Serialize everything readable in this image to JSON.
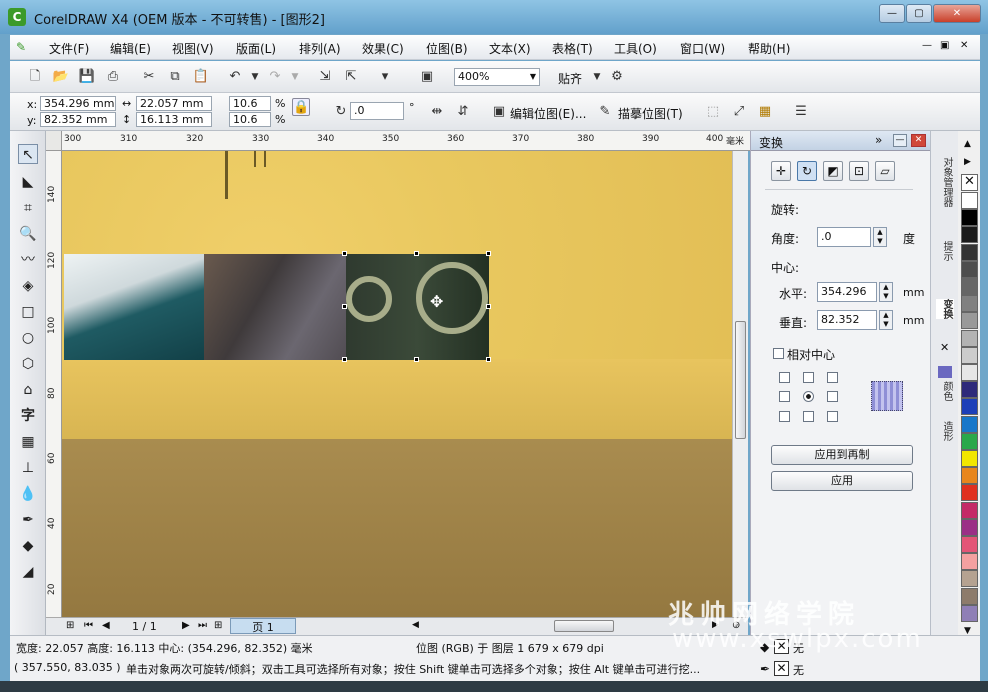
{
  "window": {
    "title": "CorelDRAW X4 (OEM 版本 - 不可转售) - [图形2]",
    "icon": "coreldraw-icon"
  },
  "menu": [
    "文件(F)",
    "编辑(E)",
    "视图(V)",
    "版面(L)",
    "排列(A)",
    "效果(C)",
    "位图(B)",
    "文本(X)",
    "表格(T)",
    "工具(O)",
    "窗口(W)",
    "帮助(H)"
  ],
  "toolbar": {
    "zoom": "400%",
    "snap_label": "贴齐"
  },
  "propbar": {
    "x_label": "x:",
    "x": "354.296 mm",
    "y_label": "y:",
    "y": "82.352 mm",
    "w": "22.057 mm",
    "h": "16.113 mm",
    "sx": "10.6",
    "sy": "10.6",
    "pct": "%",
    "rotation": ".0",
    "deg": "°",
    "edit_bitmap": "编辑位图(E)...",
    "trace_bitmap": "描摹位图(T)"
  },
  "ruler": {
    "top": [
      "300",
      "310",
      "320",
      "330",
      "340",
      "350",
      "360",
      "370",
      "380",
      "390",
      "400"
    ],
    "unit": "毫米",
    "left": [
      "140",
      "120",
      "100",
      "80",
      "60",
      "40",
      "20"
    ]
  },
  "page_nav": {
    "current": "1 / 1",
    "tab": "页 1"
  },
  "docker": {
    "title": "变换",
    "rotate_label": "旋转:",
    "angle_label": "角度:",
    "angle": ".0",
    "angle_unit": "度",
    "center_label": "中心:",
    "h_label": "水平:",
    "h": "354.296",
    "h_unit": "mm",
    "v_label": "垂直:",
    "v": "82.352",
    "v_unit": "mm",
    "relative_center": "相对中心",
    "apply_copy": "应用到再制",
    "apply": "应用"
  },
  "docker_tabs": [
    "对象管理器",
    "提示",
    "变换",
    "颜色",
    "造形"
  ],
  "palette": [
    "#ffffff",
    "#000000",
    "#1a1a1a",
    "#333333",
    "#4d4d4d",
    "#666666",
    "#808080",
    "#999999",
    "#b3b3b3",
    "#cccccc",
    "#e6e6e6",
    "#2e2a7a",
    "#1d3fb8",
    "#1877c9",
    "#2aa84a",
    "#f2e600",
    "#e8861c",
    "#e0301e",
    "#c42a66",
    "#9b2f86",
    "#e35577",
    "#f4a0a0",
    "#b5a291",
    "#8d7b6b",
    "#8f7fb6"
  ],
  "status": {
    "line1": "宽度: 22.057  高度: 16.113  中心: (354.296, 82.352)  毫米",
    "bitmap_info": "位图 (RGB) 于 图层 1 679 x 679 dpi",
    "coords": "( 357.550, 83.035 )",
    "hint": "单击对象两次可旋转/倾斜；双击工具可选择所有对象；按住 Shift 键单击可选择多个对象；按住 Alt 键单击可进行挖...",
    "fill_none": "无",
    "outline_none": "无"
  },
  "watermark": {
    "line1": "兆帅网络学院",
    "line2": "www.xswlpx.com"
  }
}
